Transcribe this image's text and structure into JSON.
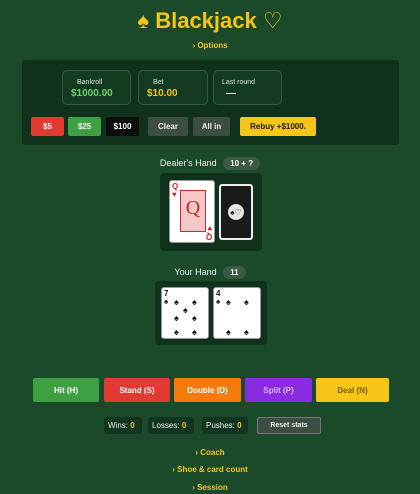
{
  "header": {
    "title": "♠ Blackjack ♡",
    "options_link": "› Options"
  },
  "stats": {
    "bankroll_label": "Bankroll",
    "bankroll_value": "$1000.00",
    "bet_label": "Bet",
    "bet_value": "$10.00",
    "last_round_label": "Last round",
    "last_round_value": "—"
  },
  "chips": {
    "five": "$5",
    "twentyfive": "$25",
    "hundred": "$100",
    "clear": "Clear",
    "all_in": "All in",
    "rebuy": "Rebuy +$1000."
  },
  "dealer": {
    "label": "Dealer's Hand",
    "total": "10 + ?",
    "cards": [
      {
        "rank": "Q",
        "suit": "♥",
        "face": "Q"
      },
      {
        "hidden": true,
        "emblem": "♠♡"
      }
    ]
  },
  "player": {
    "label": "Your Hand",
    "total": "11",
    "cards": [
      {
        "rank": "7",
        "suit": "♠"
      },
      {
        "rank": "4",
        "suit": "♠"
      }
    ]
  },
  "actions": {
    "hit": "Hit  (H)",
    "stand": "Stand  (S)",
    "double": "Double  (D)",
    "split": "Split  (P)",
    "deal": "Deal  (N)"
  },
  "record": {
    "wins_label": "Wins:",
    "wins": "0",
    "losses_label": "Losses:",
    "losses": "0",
    "pushes_label": "Pushes:",
    "pushes": "0",
    "reset": "Reset stats"
  },
  "sections": {
    "coach": "› Coach",
    "shoe": "› Shoe & card count",
    "session": "› Session"
  },
  "colors": {
    "background": "#1b4a2b",
    "accent": "#f5c518",
    "hit": "#3ea043",
    "stand": "#e03a33",
    "double": "#f57c0c",
    "split": "#8a2be2",
    "deal": "#f5c518"
  }
}
